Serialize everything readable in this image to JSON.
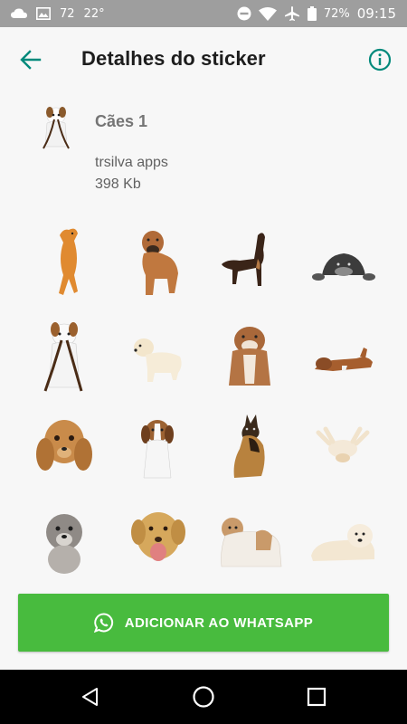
{
  "status_bar": {
    "notification_count": "72",
    "temperature": "22°",
    "battery": "72%",
    "time": "09:15"
  },
  "app_bar": {
    "title": "Detalhes do sticker"
  },
  "pack": {
    "name": "Cães 1",
    "publisher": "trsilva apps",
    "size": "398 Kb"
  },
  "stickers": [
    {
      "icon": "jumping-orange-dog"
    },
    {
      "icon": "boxer-puppy"
    },
    {
      "icon": "dachshund-howling"
    },
    {
      "icon": "schnauzer-peeking"
    },
    {
      "icon": "jack-russell-with-leash"
    },
    {
      "icon": "labrador-puppy"
    },
    {
      "icon": "bulldog-sitting"
    },
    {
      "icon": "boxer-lying"
    },
    {
      "icon": "cocker-spaniel-puppy"
    },
    {
      "icon": "beagle-puppy"
    },
    {
      "icon": "german-shepherd-sitting"
    },
    {
      "icon": "puppy-on-back"
    },
    {
      "icon": "fluffy-terrier"
    },
    {
      "icon": "labrador-tongue-out"
    },
    {
      "icon": "shih-tzu-standing"
    },
    {
      "icon": "chow-chow-puppy"
    }
  ],
  "add_button": {
    "label": "ADICIONAR AO WHATSAPP"
  },
  "colors": {
    "accent": "#00897b",
    "button": "#48bb3e",
    "status_bar": "#9e9e9e"
  }
}
